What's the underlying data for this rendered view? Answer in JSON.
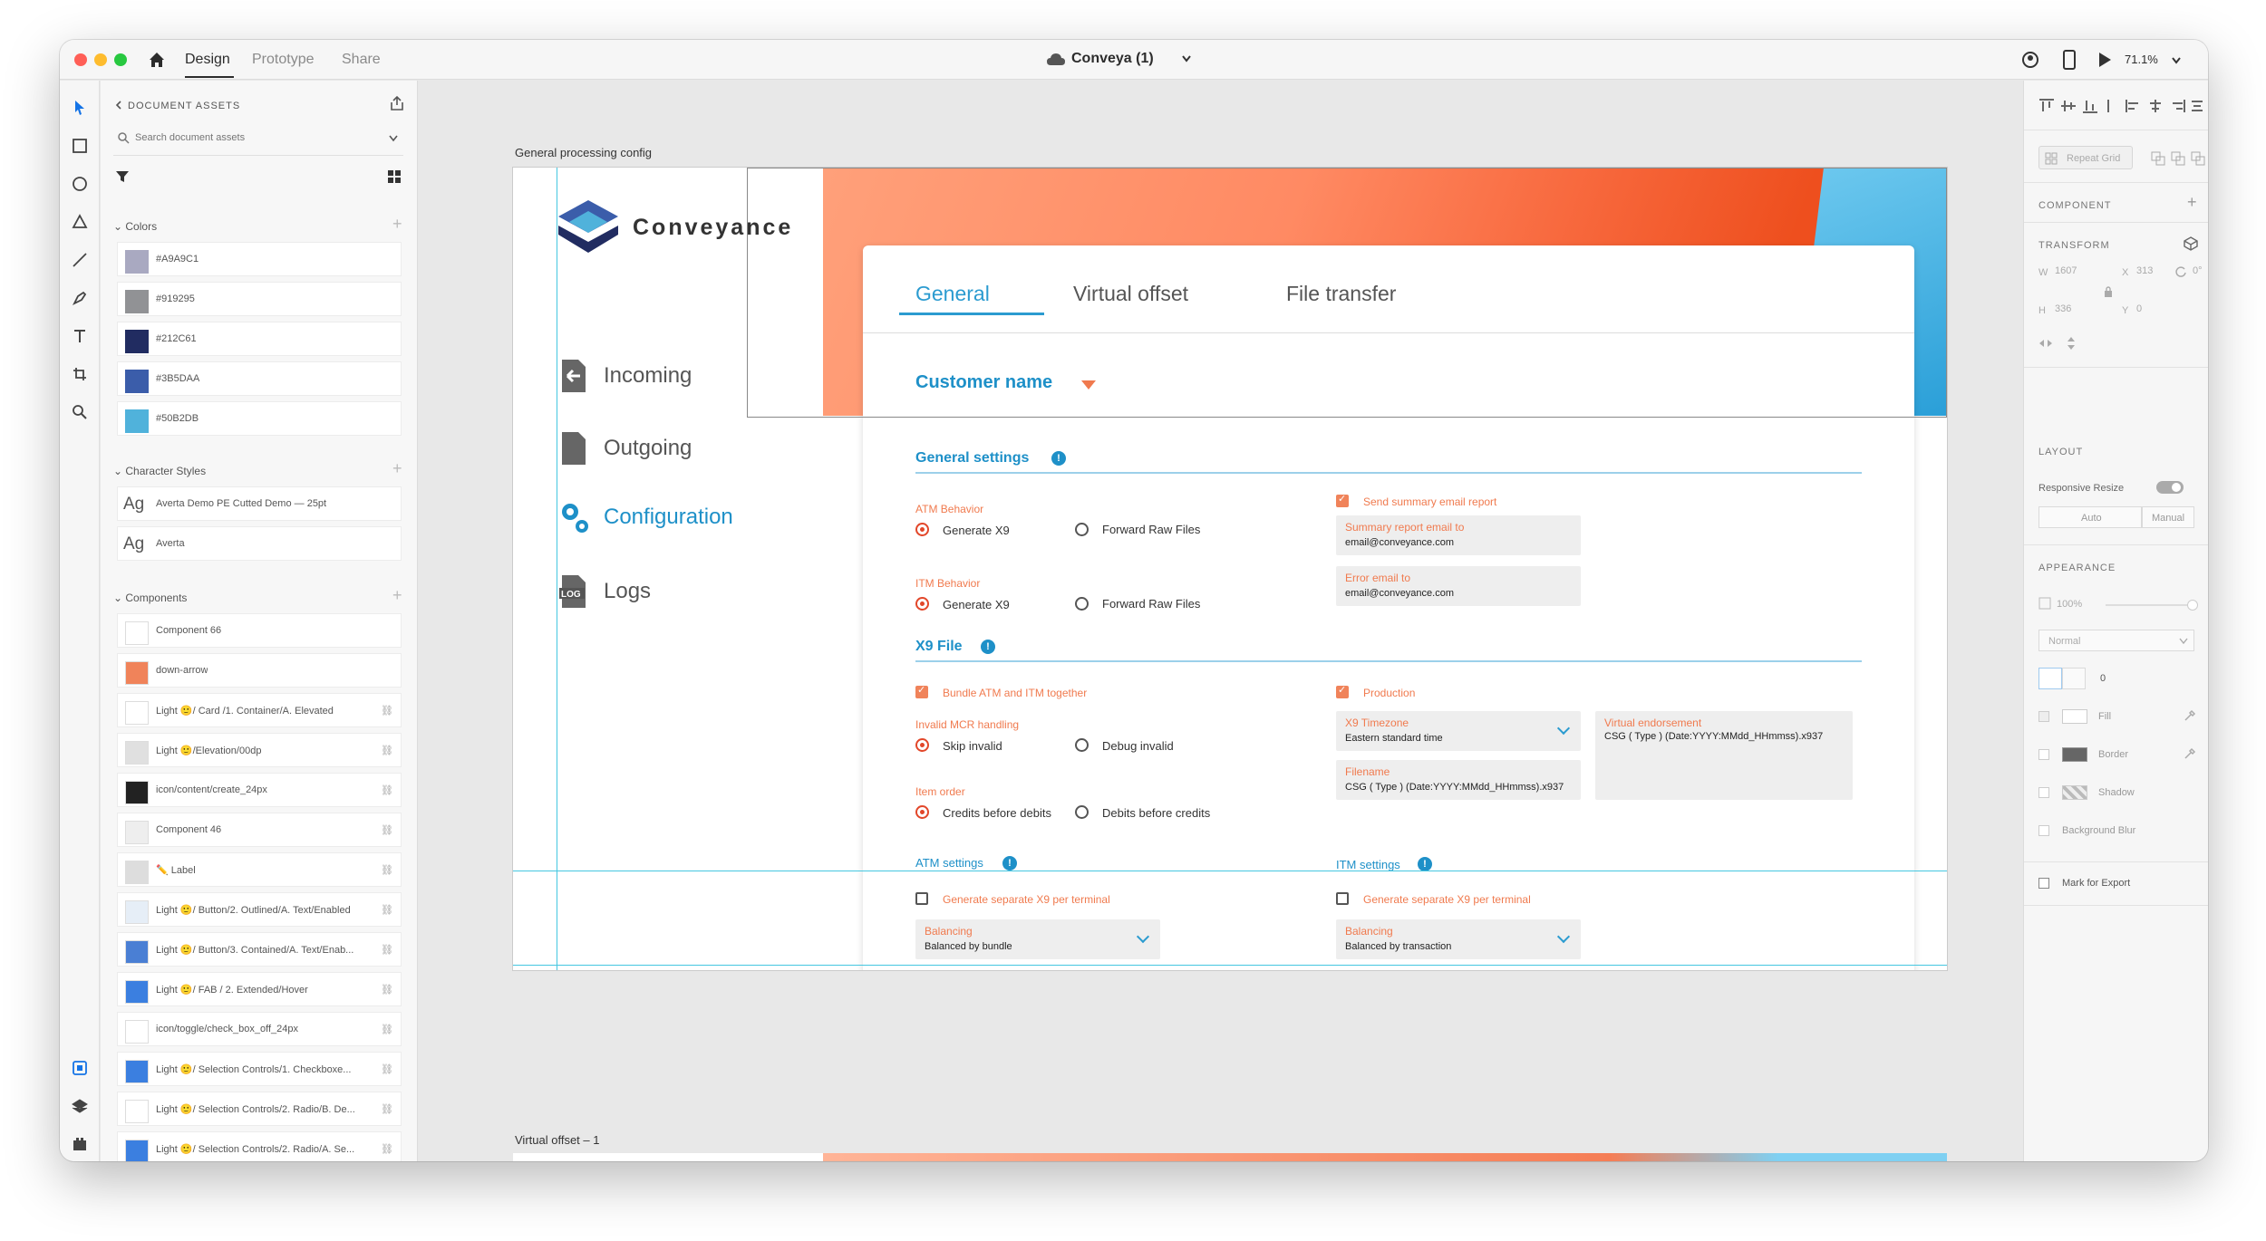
{
  "window": {
    "tabs": [
      "Design",
      "Prototype",
      "Share"
    ],
    "document_title": "Conveya (1)",
    "zoom": "71.1%"
  },
  "left_panel": {
    "header": "DOCUMENT ASSETS",
    "search_placeholder": "Search document assets",
    "colors_title": "Colors",
    "colors": [
      {
        "hex": "#A9A9C1",
        "label": "#A9A9C1"
      },
      {
        "hex": "#919295",
        "label": "#919295"
      },
      {
        "hex": "#212C61",
        "label": "#212C61"
      },
      {
        "hex": "#3B5DAA",
        "label": "#3B5DAA"
      },
      {
        "hex": "#50B2DB",
        "label": "#50B2DB"
      }
    ],
    "char_styles_title": "Character Styles",
    "char_styles": [
      {
        "sample": "Ag",
        "label": "Averta Demo PE Cutted Demo — 25pt"
      },
      {
        "sample": "Ag",
        "label": "Averta"
      }
    ],
    "components_title": "Components",
    "components": [
      "Component 66",
      "down-arrow",
      "Light 🙂/ Card /1. Container/A. Elevated",
      "Light 🙂/Elevation/00dp",
      "icon/content/create_24px",
      "Component 46",
      "✏️ Label",
      "Light 🙂/ Button/2. Outlined/A. Text/Enabled",
      "Light 🙂/ Button/3. Contained/A. Text/Enab...",
      "Light 🙂/ FAB / 2. Extended/Hover",
      "icon/toggle/check_box_off_24px",
      "Light 🙂/ Selection Controls/1. Checkboxe...",
      "Light 🙂/ Selection Controls/2. Radio/B. De...",
      "Light 🙂/ Selection Controls/2. Radio/A. Se..."
    ]
  },
  "canvas": {
    "artboard_label": "General processing config",
    "artboard2_label": "Virtual offset – 1"
  },
  "app": {
    "logo_text": "Conveyance",
    "nav": [
      {
        "label": "Incoming",
        "icon": "incoming-icon"
      },
      {
        "label": "Outgoing",
        "icon": "outgoing-icon"
      },
      {
        "label": "Configuration",
        "icon": "gears-icon"
      },
      {
        "label": "Logs",
        "icon": "log-icon"
      }
    ],
    "tabs": [
      "General",
      "Virtual offset",
      "File transfer"
    ],
    "customer_select": "Customer name",
    "general_settings": "General settings",
    "atm_behavior": "ATM Behavior",
    "atm_options": [
      "Generate X9",
      "Forward Raw Files"
    ],
    "itm_behavior": "ITM Behavior",
    "itm_options": [
      "Generate X9",
      "Forward Raw Files"
    ],
    "send_summary": "Send summary email report",
    "summary_email_label": "Summary report email to",
    "summary_email_value": "email@conveyance.com",
    "error_email_label": "Error email to",
    "error_email_value": "email@conveyance.com",
    "x9_file": "X9 File",
    "bundle": "Bundle ATM and ITM together",
    "production": "Production",
    "invalid_mcr": "Invalid MCR handling",
    "mcr_options": [
      "Skip invalid",
      "Debug invalid"
    ],
    "item_order": "Item order",
    "order_options": [
      "Credits before debits",
      "Debits before credits"
    ],
    "x9_timezone_label": "X9 Timezone",
    "x9_timezone_value": "Eastern standard time",
    "filename_label": "Filename",
    "filename_value": "CSG ( Type ) (Date:YYYY:MMdd_HHmmss).x937",
    "virtual_endorse_label": "Virtual endorsement",
    "virtual_endorse_value": "CSG ( Type ) (Date:YYYY:MMdd_HHmmss).x937",
    "atm_settings": "ATM settings",
    "itm_settings": "ITM settings",
    "separate_x9": "Generate separate X9 per terminal",
    "balancing_label": "Balancing",
    "atm_balancing_value": "Balanced by bundle",
    "itm_balancing_value": "Balanced by transaction"
  },
  "right_panel": {
    "repeat_grid": "Repeat Grid",
    "component": "COMPONENT",
    "transform": "TRANSFORM",
    "w_label": "W",
    "w": "1607",
    "h_label": "H",
    "h": "336",
    "x_label": "X",
    "x": "313",
    "y_label": "Y",
    "y": "0",
    "rotation": "0°",
    "layout": "LAYOUT",
    "responsive_resize": "Responsive Resize",
    "auto": "Auto",
    "manual": "Manual",
    "appearance": "APPEARANCE",
    "opacity": "100%",
    "blend": "Normal",
    "radius": "0",
    "fill": "Fill",
    "border": "Border",
    "shadow": "Shadow",
    "background_blur": "Background Blur",
    "mark_export": "Mark for Export"
  }
}
